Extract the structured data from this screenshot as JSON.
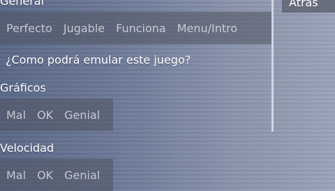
{
  "sections": {
    "general": {
      "heading": "General",
      "options": [
        "Perfecto",
        "Jugable",
        "Funciona",
        "Menu/Intro"
      ]
    },
    "question": "¿Como podrá emular este juego?",
    "graphics": {
      "heading": "Gráficos",
      "options": [
        "Mal",
        "OK",
        "Genial"
      ]
    },
    "speed": {
      "heading": "Velocidad",
      "options": [
        "Mal",
        "OK",
        "Genial"
      ]
    }
  },
  "back_button": {
    "label": "Atrás"
  },
  "colors": {
    "background": "#6d7a98",
    "choice_bar": "#505460",
    "text": "#ffffff",
    "choice_text": "#e1e4eb"
  }
}
